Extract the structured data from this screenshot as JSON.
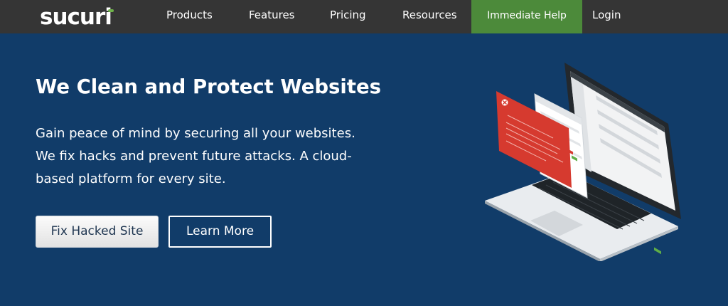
{
  "brand": {
    "logo_text": "sucuri"
  },
  "nav": {
    "items": [
      "Products",
      "Features",
      "Pricing",
      "Resources"
    ],
    "help_label": "Immediate Help",
    "login_label": "Login"
  },
  "hero": {
    "title": "We Clean and Protect Websites",
    "subtitle_lines": [
      "Gain peace of mind by securing all your websites.",
      "We fix hacks and prevent future attacks. A cloud-",
      "based platform for every site."
    ],
    "primary_button": "Fix Hacked Site",
    "secondary_button": "Learn More"
  },
  "colors": {
    "hero_bg": "#113c69",
    "nav_bg": "#353535",
    "help_bg": "#4c8a3a",
    "alert_red": "#d63a2f"
  },
  "illustration": {
    "alert_icon": "close-icon",
    "device": "laptop-icon"
  }
}
